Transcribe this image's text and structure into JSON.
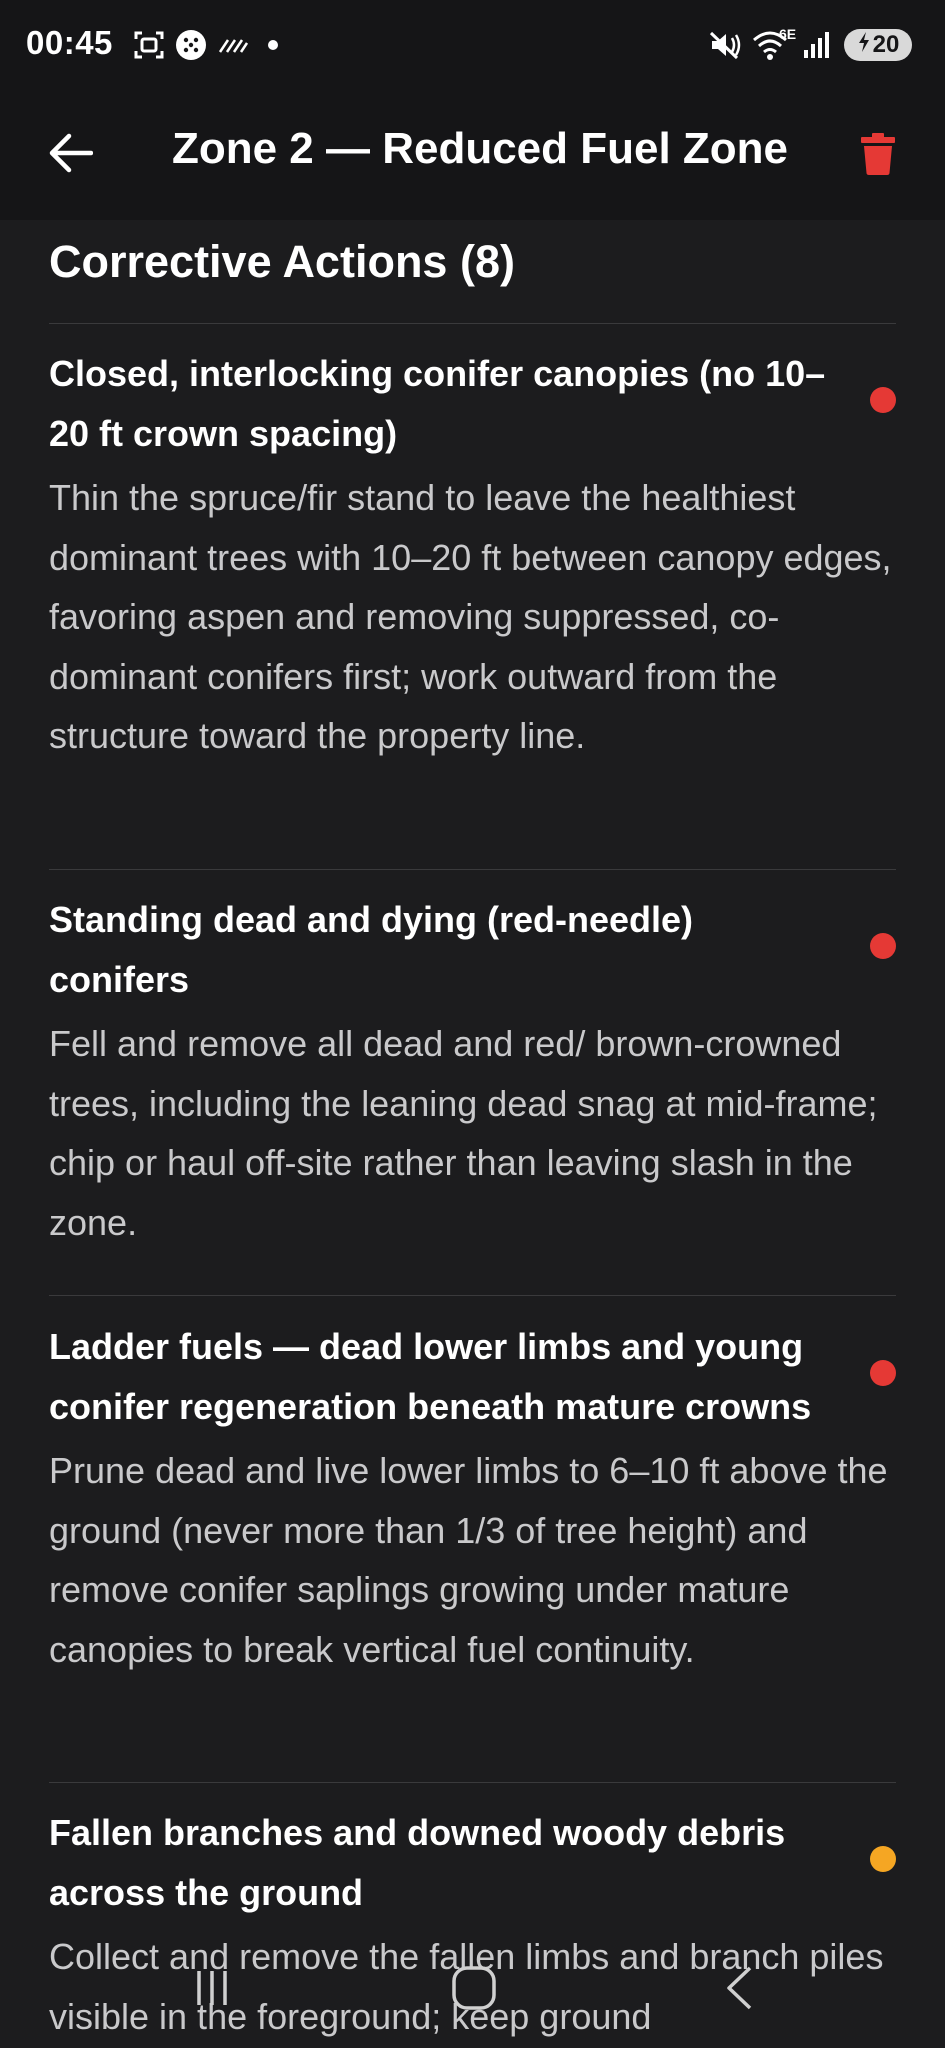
{
  "status_bar": {
    "time": "00:45",
    "icons": [
      "screenshot-icon",
      "dots-circle-icon",
      "stripes-icon",
      "dot-icon",
      "mute-icon",
      "wifi-6e-icon",
      "signal-icon"
    ],
    "wifi_label": "6E",
    "battery_level": "20"
  },
  "app_bar": {
    "back_icon": "arrow-left-icon",
    "title": "Zone 2 — Reduced Fuel Zone",
    "delete_icon": "trash-icon",
    "delete_color": "#e53935"
  },
  "section": {
    "title": "Corrective Actions (8)"
  },
  "colors": {
    "severity_high": "#e53935",
    "severity_medium": "#f5a623",
    "background": "#1c1c1e",
    "bar_background": "#151517",
    "divider": "#3a3a3c"
  },
  "actions": [
    {
      "title": "Closed, interlocking conifer canopies (no 10–20 ft crown spacing)",
      "description": "Thin the spruce/fir stand to leave the healthiest dominant trees with 10–20 ft between canopy edges, favoring aspen and removing suppressed, co-dominant conifers first; work outward from the structure toward the property line.",
      "severity_color": "#e53935"
    },
    {
      "title": "Standing dead and dying (red-needle) conifers",
      "description": "Fell and remove all dead and red/ brown-crowned trees, including the leaning dead snag at mid-frame; chip or haul off-site rather than leaving slash in the zone.",
      "severity_color": "#e53935"
    },
    {
      "title": "Ladder fuels — dead lower limbs and young conifer regeneration beneath mature crowns",
      "description": "Prune dead and live lower limbs to 6–10 ft above the ground (never more than 1/3 of tree height) and remove conifer saplings growing under mature canopies to break vertical fuel continuity.",
      "severity_color": "#e53935"
    },
    {
      "title": "Fallen branches and downed woody debris across the ground",
      "description": "Collect and remove the fallen limbs and branch piles visible in the foreground; keep ground",
      "severity_color": "#f5a623"
    }
  ],
  "nav_bar": {
    "icons": [
      "recent-apps-icon",
      "home-icon",
      "back-nav-icon"
    ]
  }
}
